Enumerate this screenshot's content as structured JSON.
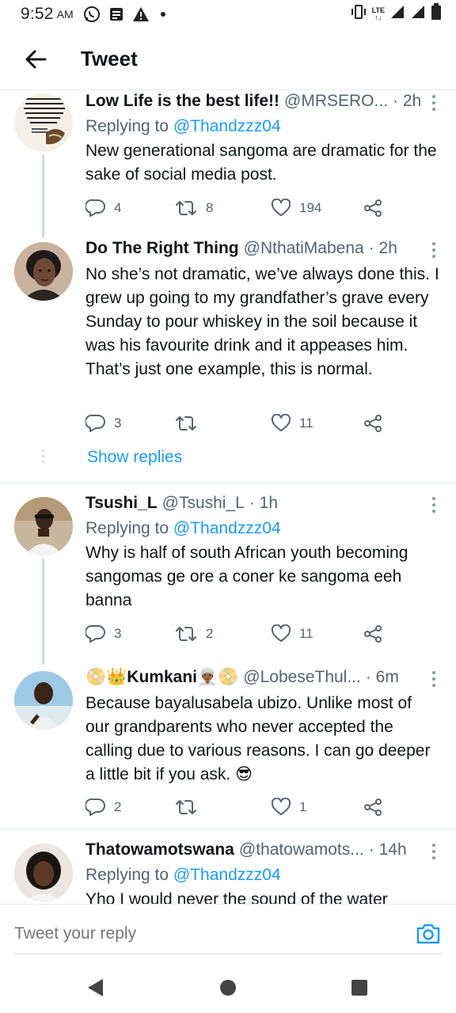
{
  "status_bar": {
    "time": "9:52",
    "ampm": "AM",
    "lte": "LTE"
  },
  "header": {
    "title": "Tweet"
  },
  "tweets": [
    {
      "name": "Low Life is the best life!!",
      "handle": "@MRSERO...",
      "time": "· 2h",
      "replying_prefix": "Replying to",
      "replying_to": "@Thandzzz04",
      "text": "New generational sangoma are dramatic for the sake of social media post.",
      "replies": "4",
      "retweets": "8",
      "likes": "194",
      "avatar_text": "...nly in Africa wi... ...ieves be regrouping to loot again and the youths whose future is being stolen will be celebrating it..."
    },
    {
      "name": "Do The Right Thing",
      "handle": "@NthatiMabena",
      "time": "· 2h",
      "text": "No she’s not dramatic, we’ve always done this. I grew up going to my grandfather’s grave every Sunday to pour whiskey in the soil because it was his favourite drink and it appeases him. That’s just one example, this is normal.",
      "replies": "3",
      "retweets": "",
      "likes": "11",
      "show_replies": "Show replies"
    },
    {
      "name": "Tsushi_L",
      "handle": "@Tsushi_L",
      "time": "· 1h",
      "replying_prefix": "Replying to",
      "replying_to": "@Thandzzz04",
      "text": "Why is half of south African youth becoming sangomas ge ore a coner ke sangoma eeh banna",
      "replies": "3",
      "retweets": "2",
      "likes": "11"
    },
    {
      "name": "📀👑Kumkani👳🏾‍♂️📀",
      "handle": "@LobeseThul...",
      "time": "· 6m",
      "text": "Because bayalusabela ubizo. Unlike most of our grandparents who never accepted the calling due to various reasons. I can go deeper a little bit if you ask. 😎",
      "replies": "2",
      "retweets": "",
      "likes": "1"
    },
    {
      "name": "Thatowamotswana",
      "handle": "@thatowamots...",
      "time": "· 14h",
      "replying_prefix": "Replying to",
      "replying_to": "@Thandzzz04",
      "text": "Yho I would never the sound of the water"
    }
  ],
  "composer": {
    "placeholder": "Tweet your reply"
  },
  "colors": {
    "accent": "#1d9bf0",
    "muted": "#536471",
    "text": "#0f1419",
    "divider": "#e6ecf0"
  },
  "icons": [
    "back-arrow-icon",
    "reply-icon",
    "retweet-icon",
    "like-icon",
    "share-icon",
    "more-icon",
    "camera-icon",
    "nav-back-icon",
    "nav-home-icon",
    "nav-recents-icon"
  ]
}
